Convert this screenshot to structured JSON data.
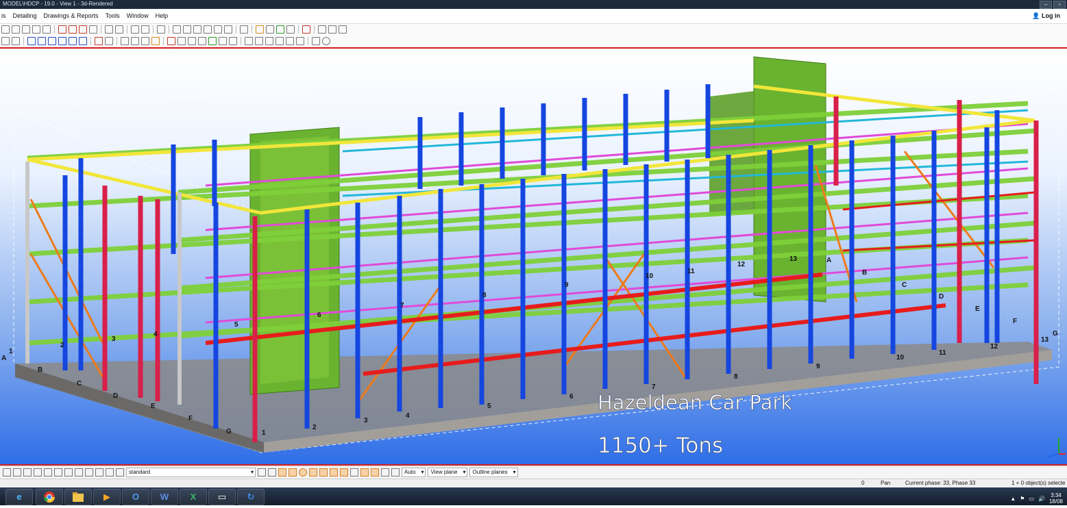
{
  "window": {
    "title": "MODEL\\HDCP - 19.0 - View 1 - 3d-Rendered",
    "buttons": [
      "–",
      "▫"
    ]
  },
  "menu": {
    "items": [
      "is",
      "Detailing",
      "Drawings & Reports",
      "Tools",
      "Window",
      "Help"
    ],
    "login": "Log in"
  },
  "viewport": {
    "grid_rows_left": [
      "A",
      "B",
      "C",
      "D",
      "E",
      "F",
      "G"
    ],
    "grid_cols_front": [
      "1",
      "2",
      "3",
      "4",
      "5",
      "6",
      "7",
      "8",
      "9",
      "10",
      "11",
      "12",
      "13"
    ],
    "grid_rows_right": [
      "A",
      "B",
      "C",
      "D",
      "E",
      "F",
      "G"
    ],
    "mid_labels": [
      "5",
      "6",
      "7",
      "8",
      "9",
      "10",
      "11",
      "12",
      "13"
    ],
    "left_col_labels": [
      "1",
      "2",
      "3",
      "4"
    ],
    "overlay_title": "Hazeldean Car Park",
    "overlay_subtitle": "1150+ Tons",
    "colors": {
      "column_blue": "#1546e0",
      "column_red": "#d8204a",
      "beam_green": "#7fd03a",
      "brace_orange": "#ee7a1a",
      "beam_magenta": "#e04ad8",
      "beam_cyan": "#22b7d8",
      "beam_yellow": "#f2e63a",
      "core_green": "#6ab330"
    }
  },
  "bottom": {
    "filter": "standard",
    "snap": "Auto",
    "plane": "View plane",
    "outline": "Outline planes"
  },
  "status": {
    "zero": "0",
    "mode": "Pan",
    "phase": "Current phase: 33, Phase 33",
    "selection": "1 + 0 object(s) selecte"
  },
  "taskbar": {
    "apps": [
      "ie",
      "chrome",
      "explorer",
      "media",
      "outlook",
      "word",
      "excel",
      "window",
      "tekla"
    ],
    "time": "3:34",
    "date": "18/08"
  }
}
